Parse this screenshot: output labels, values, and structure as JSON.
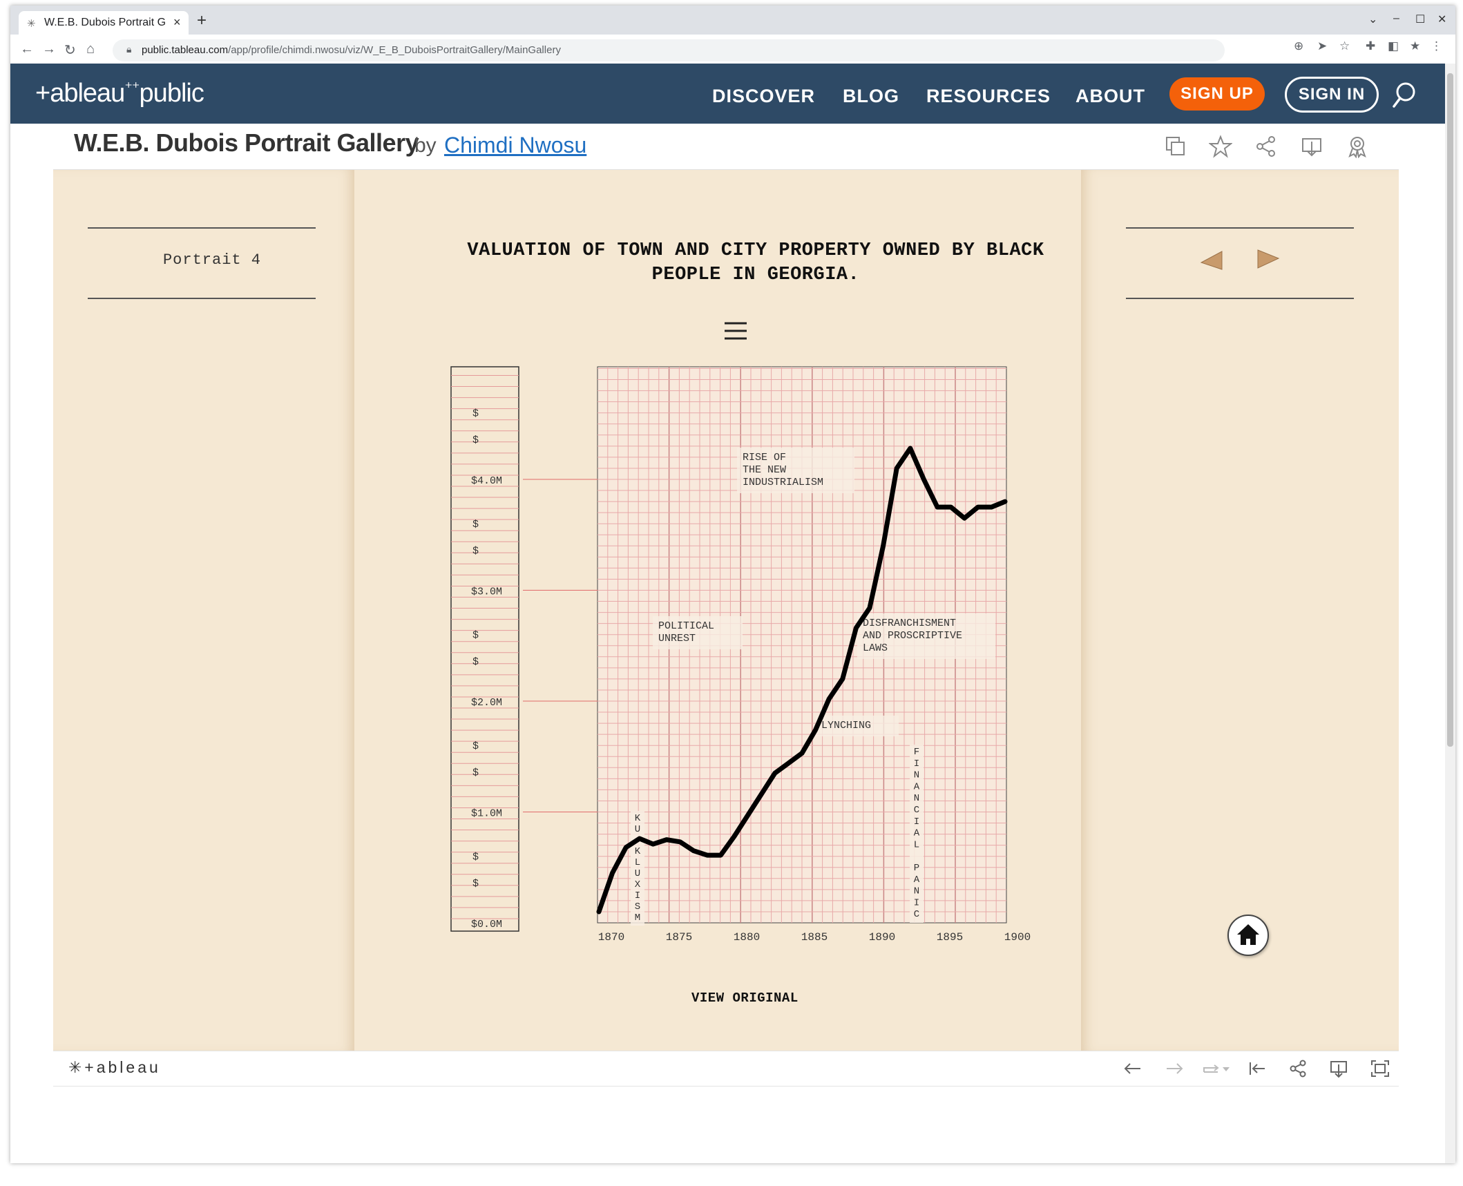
{
  "browser": {
    "tab_title": "W.E.B. Dubois Portrait G",
    "tab_icon": "tableau-favicon",
    "new_tab": "+",
    "url_host": "public.tableau.com",
    "url_path": "/app/profile/chimdi.nwosu/viz/W_E_B_DuboisPortraitGallery/MainGallery"
  },
  "header": {
    "logo": "+ableau",
    "logo_suffix": "public",
    "nav": [
      "DISCOVER",
      "BLOG",
      "RESOURCES",
      "ABOUT"
    ],
    "sign_up": "SIGN UP",
    "sign_in": "SIGN IN",
    "colors": {
      "bar": "#2e4a66",
      "sign_up": "#f4610a"
    }
  },
  "viz_header": {
    "title": "W.E.B. Dubois Portrait Gallery",
    "by": "by",
    "author": "Chimdi Nwosu",
    "actions": [
      "copy-icon",
      "star-icon",
      "share-icon",
      "download-icon",
      "award-icon"
    ]
  },
  "viz": {
    "portrait_label": "Portrait 4",
    "view_original": "VIEW ORIGINAL",
    "nav_arrows": [
      "arrow-left-icon",
      "arrow-right-icon"
    ],
    "home": "home-icon"
  },
  "chart_data": {
    "type": "line",
    "title": "VALUATION OF TOWN AND CITY PROPERTY OWNED BY BLACK PEOPLE IN GEORGIA.",
    "x": [
      1870,
      1871,
      1872,
      1873,
      1874,
      1875,
      1876,
      1877,
      1878,
      1879,
      1880,
      1881,
      1882,
      1883,
      1884,
      1885,
      1886,
      1887,
      1888,
      1889,
      1890,
      1891,
      1892,
      1893,
      1894,
      1895,
      1896,
      1897,
      1898,
      1899,
      1900
    ],
    "values": [
      0.1,
      0.45,
      0.68,
      0.76,
      0.71,
      0.75,
      0.73,
      0.65,
      0.61,
      0.61,
      0.78,
      0.97,
      1.16,
      1.35,
      1.44,
      1.53,
      1.74,
      2.02,
      2.2,
      2.66,
      2.84,
      3.4,
      4.1,
      4.28,
      4.0,
      3.75,
      3.75,
      3.65,
      3.75,
      3.75,
      3.8
    ],
    "xticks": [
      "1870",
      "1875",
      "1880",
      "1885",
      "1890",
      "1895",
      "1900"
    ],
    "yticks": [
      "$0.0M",
      "$1.0M",
      "$2.0M",
      "$3.0M",
      "$4.0M"
    ],
    "ytick_minor_label": "$",
    "ylim": [
      0,
      4.4
    ],
    "grid": true,
    "annotations": [
      {
        "text": [
          "RISE OF",
          "THE NEW",
          "INDUSTRIALISM"
        ]
      },
      {
        "text": [
          "POLITICAL",
          "UNREST"
        ]
      },
      {
        "text": [
          "DISFRANCHISMENT",
          "AND PROSCRIPTIVE",
          "LAWS"
        ]
      },
      {
        "text": [
          "LYNCHING"
        ]
      },
      {
        "text": "KU KLUXISM",
        "vertical": true
      },
      {
        "text": "FINANCIAL PANIC",
        "vertical": true
      }
    ],
    "colors": {
      "line": "#000000",
      "grid": "#e8a9a9",
      "background": "#f5e8d3"
    }
  },
  "toolbar": {
    "brand": "+ableau",
    "icons": [
      "undo-icon",
      "redo-icon",
      "revert-icon",
      "dropdown-icon",
      "reset-icon",
      "share-icon",
      "download-icon",
      "fullscreen-icon"
    ]
  }
}
